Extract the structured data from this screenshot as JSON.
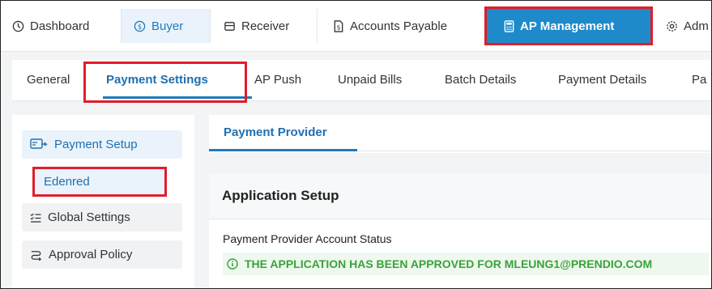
{
  "topnav": {
    "items": [
      {
        "label": "Dashboard",
        "icon": "dashboard-icon"
      },
      {
        "label": "Buyer",
        "icon": "dollar-circle-icon"
      },
      {
        "label": "Receiver",
        "icon": "inbox-tray-icon"
      },
      {
        "label": "Accounts Payable",
        "icon": "document-dollar-icon"
      },
      {
        "label": "AP Management",
        "icon": "calculator-icon"
      },
      {
        "label": "Adm",
        "icon": "gear-icon"
      }
    ]
  },
  "tabs": [
    "General",
    "Payment Settings",
    "AP Push",
    "Unpaid Bills",
    "Batch Details",
    "Payment Details",
    "Pa"
  ],
  "sidebar": {
    "payment_setup": "Payment Setup",
    "edenred": "Edenred",
    "global_settings": "Global Settings",
    "approval_policy": "Approval Policy"
  },
  "provider": {
    "tab": "Payment Provider"
  },
  "setup": {
    "title": "Application Setup",
    "status_label": "Payment Provider Account Status",
    "status_message": "THE APPLICATION HAS BEEN APPROVED FOR MLEUNG1@PRENDIO.COM"
  },
  "colors": {
    "accent": "#1e8ac9",
    "active_text": "#1f6fb0",
    "highlight": "#e11d2a",
    "success": "#3aa23a"
  }
}
